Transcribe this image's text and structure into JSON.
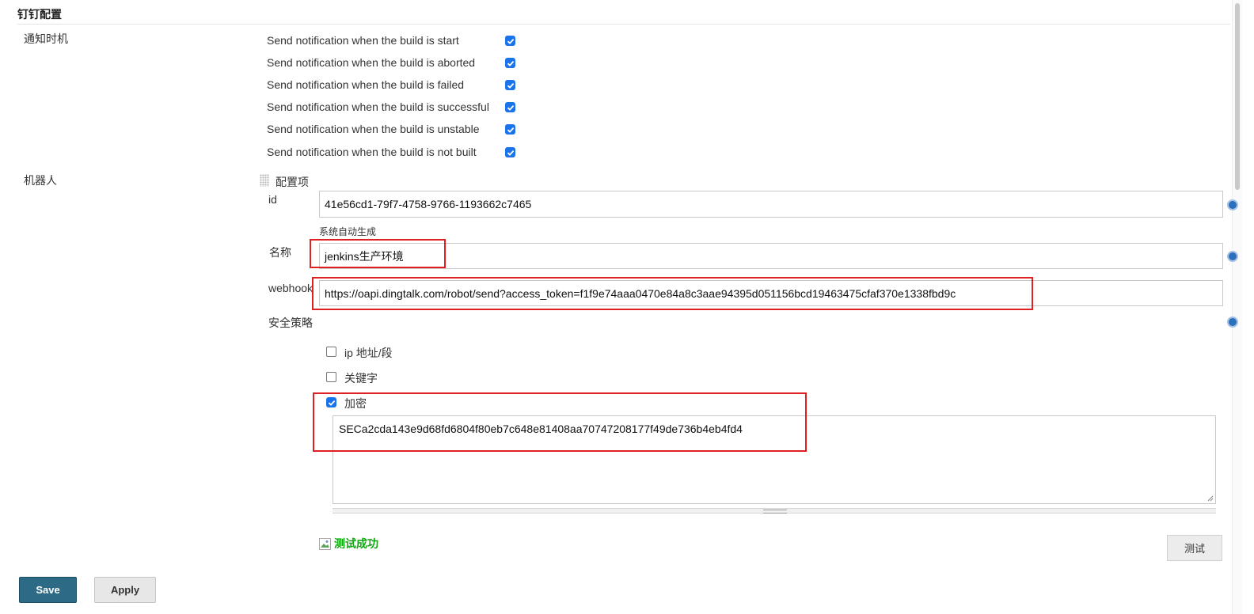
{
  "section": {
    "title": "钉钉配置"
  },
  "notify": {
    "label": "通知时机",
    "items": [
      {
        "label": "Send notification when the build is start",
        "checked": true
      },
      {
        "label": "Send notification when the build is aborted",
        "checked": true
      },
      {
        "label": "Send notification when the build is failed",
        "checked": true
      },
      {
        "label": "Send notification when the build is successful",
        "checked": true
      },
      {
        "label": "Send notification when the build is unstable",
        "checked": true
      },
      {
        "label": "Send notification when the build is not built",
        "checked": true
      }
    ]
  },
  "robot": {
    "label": "机器人",
    "group_label": "配置项",
    "id": {
      "label": "id",
      "value": "41e56cd1-79f7-4758-9766-1193662c7465",
      "hint": "系统自动生成"
    },
    "name": {
      "label": "名称",
      "value": "jenkins生产环境"
    },
    "webhook": {
      "label": "webhook",
      "value": "https://oapi.dingtalk.com/robot/send?access_token=f1f9e74aaa0470e84a8c3aae94395d051156bcd19463475cfaf370e1338fbd9c"
    },
    "security": {
      "label": "安全策略",
      "options": [
        {
          "label": "ip 地址/段",
          "checked": false
        },
        {
          "label": "关键字",
          "checked": false
        },
        {
          "label": "加密",
          "checked": true
        }
      ],
      "secret": "SECa2cda143e9d68fd6804f80eb7c648e81408aa70747208177f49de736b4eb4fd4"
    },
    "test": {
      "status": "测试成功",
      "button": "测试"
    }
  },
  "actions": {
    "save": "Save",
    "apply": "Apply"
  },
  "colors": {
    "accent": "#1a73e8",
    "save": "#2d6a86",
    "success": "#11a511",
    "highlight": "#e02020"
  },
  "icons": {
    "check": "check-icon",
    "help": "help-icon",
    "grip": "drag-handle-icon",
    "image": "broken-image-icon"
  }
}
